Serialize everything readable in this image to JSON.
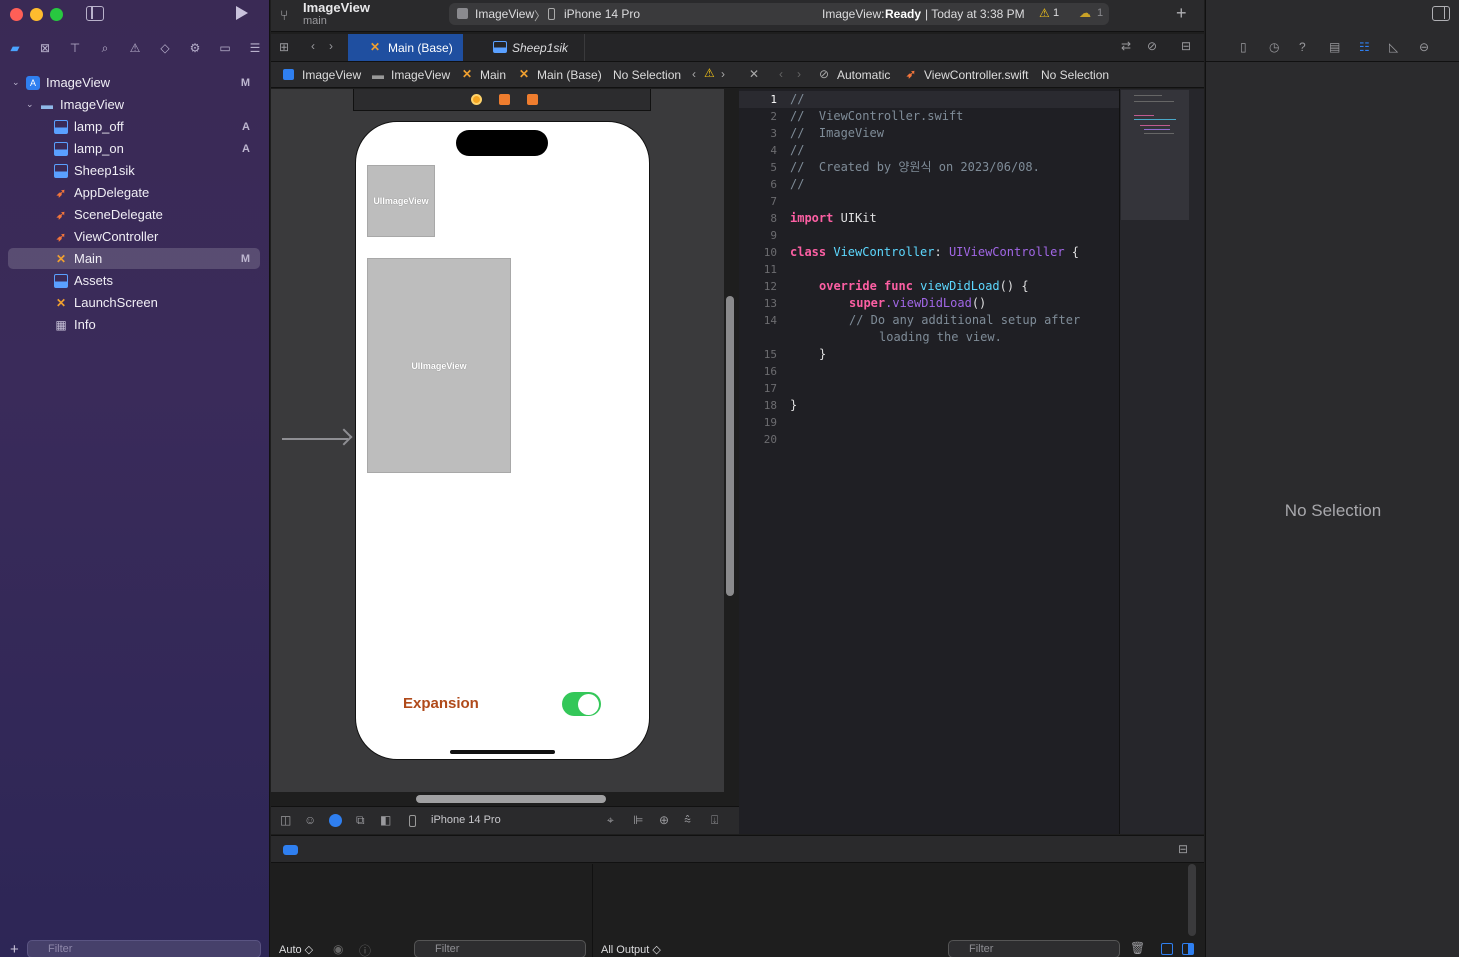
{
  "window": {
    "project_title": "ImageView",
    "branch": "main"
  },
  "toolbar": {
    "scheme_target": "ImageView",
    "device": "iPhone 14 Pro",
    "status_prefix": "ImageView:",
    "status_state": "Ready",
    "status_time": "| Today at 3:38 PM",
    "warning_count": "1",
    "issue_count": "1",
    "add_icon": "+"
  },
  "navigator": {
    "items": [
      {
        "label": "ImageView",
        "badge": "M"
      },
      {
        "label": "ImageView",
        "badge": ""
      },
      {
        "label": "lamp_off",
        "badge": "A"
      },
      {
        "label": "lamp_on",
        "badge": "A"
      },
      {
        "label": "Sheep1sik",
        "badge": ""
      },
      {
        "label": "AppDelegate",
        "badge": ""
      },
      {
        "label": "SceneDelegate",
        "badge": ""
      },
      {
        "label": "ViewController",
        "badge": ""
      },
      {
        "label": "Main",
        "badge": "M"
      },
      {
        "label": "Assets",
        "badge": ""
      },
      {
        "label": "LaunchScreen",
        "badge": ""
      },
      {
        "label": "Info",
        "badge": ""
      }
    ],
    "filter_placeholder": "Filter"
  },
  "tabs": [
    {
      "label": "Main (Base)"
    },
    {
      "label": "Sheep1sik"
    }
  ],
  "jumpbar_left": [
    "ImageView",
    "ImageView",
    "Main",
    "Main (Base)",
    "No Selection"
  ],
  "jumpbar_right": [
    "Automatic",
    "ViewController.swift",
    "No Selection"
  ],
  "canvas": {
    "image_view_1_label": "UIImageView",
    "image_view_2_label": "UIImageView",
    "expansion_label": "Expansion",
    "toggle_on": true,
    "device_label": "iPhone 14 Pro"
  },
  "code": {
    "line_numbers": [
      "1",
      "2",
      "3",
      "4",
      "5",
      "6",
      "7",
      "8",
      "9",
      "10",
      "11",
      "12",
      "13",
      "14",
      "15",
      "16",
      "17",
      "18",
      "19",
      "20"
    ],
    "c1": "//",
    "c2": "//  ViewController.swift",
    "c3": "//  ImageView",
    "c4": "//",
    "c5": "//  Created by 양원식 on 2023/06/08.",
    "c6": "//",
    "import_kw": "import",
    "import_mod": " UIKit",
    "class_kw": "class",
    "class_name": " ViewController",
    "class_colon": ": ",
    "class_super": "UIViewController",
    "class_brace": " {",
    "override_kw": "override",
    "func_kw": "func",
    "func_name": "viewDidLoad",
    "func_tail": "() {",
    "super_kw": "super",
    "super_call": ".viewDidLoad",
    "super_tail": "()",
    "comment_a": "// Do any additional setup after",
    "comment_b": "loading the view.",
    "close_inner": "}",
    "close_outer": "}"
  },
  "inspector": {
    "empty_label": "No Selection"
  },
  "debug": {
    "auto_label": "Auto ◇",
    "filter_left": "Filter",
    "output_label": "All Output ◇",
    "filter_right": "Filter"
  }
}
